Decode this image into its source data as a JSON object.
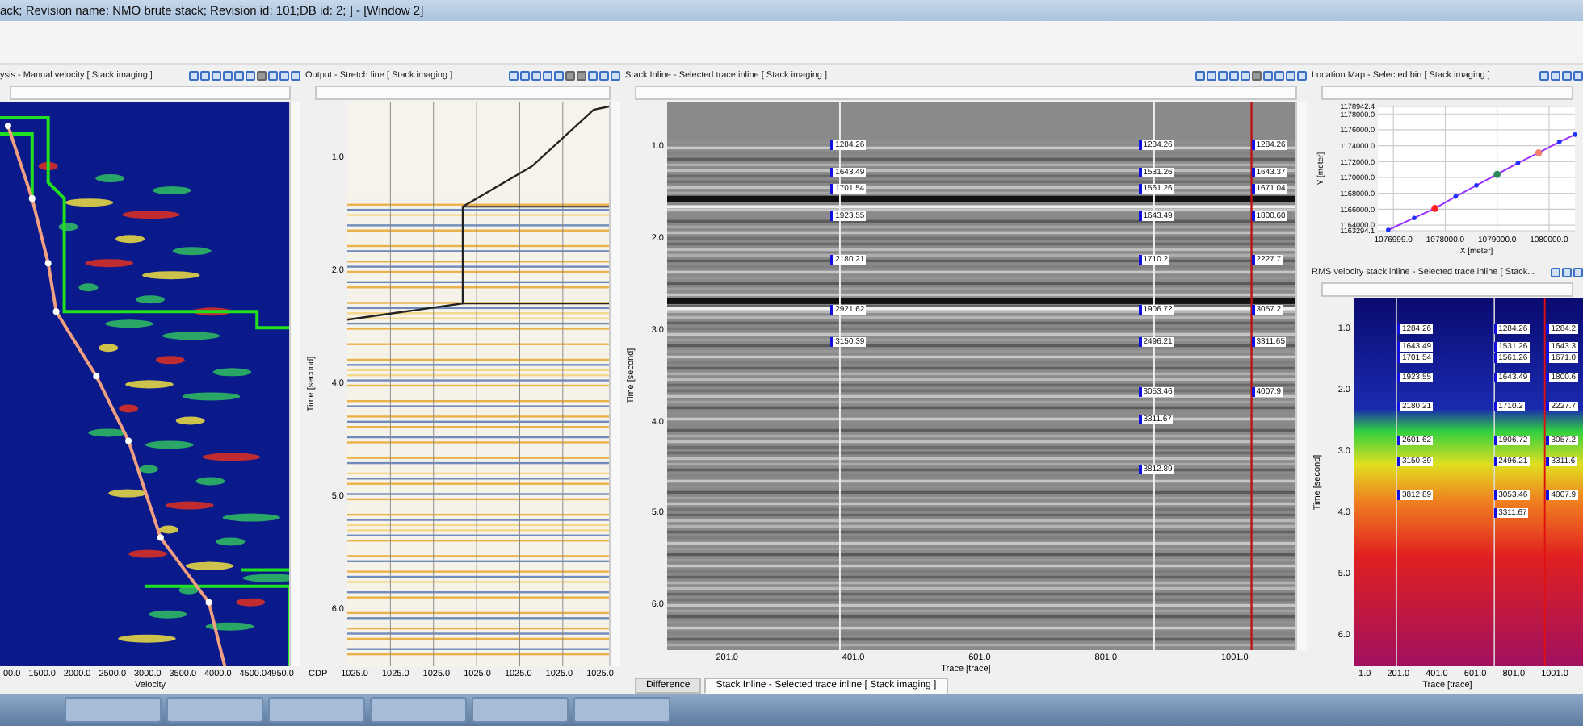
{
  "window": {
    "title": "ack; Revision name: NMO brute stack; Revision id: 101;DB id: 2; ] - [Window 2]"
  },
  "velocity_panel": {
    "title": "ysis - Manual velocity [ Stack imaging ]",
    "xticks": [
      "00.0",
      "1500.0",
      "2000.0",
      "2500.0",
      "3000.0",
      "3500.0",
      "4000.0",
      "4500.04950.0"
    ],
    "xlabel": "Velocity"
  },
  "stretch_panel": {
    "title": "Output - Stretch line [ Stack imaging ]",
    "ylabel": "Time [second]",
    "yticks": [
      "1.0",
      "2.0",
      "4.0",
      "5.0",
      "6.0"
    ],
    "xprefix": "CDP",
    "xticks": [
      "1025.0",
      "1025.0",
      "1025.0",
      "1025.0",
      "1025.0",
      "1025.0",
      "1025.0"
    ]
  },
  "stack_panel": {
    "title": "Stack Inline - Selected trace inline [ Stack imaging ]",
    "ylabel": "Time [second]",
    "yticks": [
      "1.0",
      "2.0",
      "3.0",
      "4.0",
      "5.0",
      "6.0"
    ],
    "xticks": [
      "201.0",
      "401.0",
      "601.0",
      "801.0",
      "1001.0"
    ],
    "xlabel": "Trace [trace]",
    "picks": [
      [
        "1284.26",
        "1643.49",
        "1701.54",
        "1923.55",
        "2180.21",
        "2921.62",
        "3150.39"
      ],
      [
        "1284.26",
        "1531.26",
        "1561.26",
        "1643.49",
        "1710.2",
        "1906.72",
        "2496.21",
        "3053.46",
        "3311.67",
        "3812.89"
      ],
      [
        "1284.26",
        "1643.37",
        "1671.04",
        "1800.60",
        "2227.7",
        "3057.2",
        "3311.65",
        "4007.9"
      ]
    ],
    "tabs": [
      {
        "label": "Difference",
        "selected": false
      },
      {
        "label": "Stack Inline - Selected trace inline [ Stack imaging ]",
        "selected": true
      }
    ]
  },
  "map_panel": {
    "title": "Location Map - Selected bin [ Stack imaging ]",
    "chart_data": {
      "type": "line",
      "grid": true,
      "xlabel": "X [meter]",
      "ylabel": "Y [meter]",
      "x": [
        1076900,
        1077400,
        1077800,
        1078200,
        1078600,
        1079000,
        1079400,
        1079800,
        1080200,
        1080500
      ],
      "series": [
        {
          "color": "#9933ff",
          "values": [
            1163400,
            1164900,
            1166100,
            1167600,
            1169000,
            1170400,
            1171800,
            1173100,
            1174500,
            1175400
          ]
        }
      ],
      "xlim": [
        1076700,
        1080500
      ],
      "ylim": [
        1163294.1,
        1178942.4
      ],
      "xticks": [
        {
          "value": 1076999,
          "label": "1076999.0"
        },
        {
          "value": 1078000,
          "label": "1078000.0"
        },
        {
          "value": 1079000,
          "label": "1079000.0"
        },
        {
          "value": 1080000,
          "label": "1080000.0"
        }
      ],
      "yticks": [
        {
          "value": 1163294.1,
          "label": "1163294.1"
        },
        {
          "value": 1164000,
          "label": "1164000.0"
        },
        {
          "value": 1166000,
          "label": "1166000.0"
        },
        {
          "value": 1168000,
          "label": "1168000.0"
        },
        {
          "value": 1170000,
          "label": "1170000.0"
        },
        {
          "value": 1172000,
          "label": "1172000.0"
        },
        {
          "value": 1174000,
          "label": "1174000.0"
        },
        {
          "value": 1176000,
          "label": "1176000.0"
        },
        {
          "value": 1178000,
          "label": "1178000.0"
        },
        {
          "value": 1178942.4,
          "label": "1178942.4"
        }
      ]
    },
    "highlights": [
      {
        "color": "#ff2020"
      },
      {
        "color": "#2e8b57"
      },
      {
        "color": "#f08070"
      }
    ]
  },
  "rms_panel": {
    "title": "RMS velocity stack inline - Selected trace inline [ Stack...",
    "ylabel": "Time [second]",
    "yticks": [
      "1.0",
      "2.0",
      "3.0",
      "4.0",
      "5.0",
      "6.0"
    ],
    "xticks": [
      "1.0",
      "201.0",
      "401.0",
      "601.0",
      "801.0",
      "1001.0"
    ],
    "xlabel": "Trace [trace]",
    "picks": [
      [
        "1284.26",
        "1643.49",
        "1701.54",
        "1923.55",
        "2180.21",
        "2601.62",
        "3150.39",
        "3812.89"
      ],
      [
        "1284.26",
        "1531.26",
        "1561.26",
        "1643.49",
        "1710.2",
        "1906.72",
        "2496.21",
        "3053.46",
        "3311.67"
      ],
      [
        "1284.2",
        "1643.3",
        "1671.0",
        "1800.6",
        "2227.7",
        "3057.2",
        "3311.6",
        "4007.9"
      ]
    ]
  }
}
